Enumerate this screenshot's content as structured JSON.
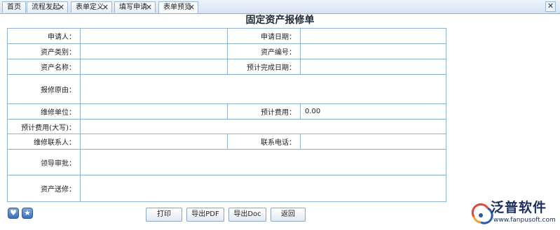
{
  "tabs": [
    {
      "label": "首页",
      "closable": false
    },
    {
      "label": "流程发起",
      "closable": true
    },
    {
      "label": "表单定义",
      "closable": true
    },
    {
      "label": "填写申请",
      "closable": true
    },
    {
      "label": "表单预览",
      "closable": true,
      "active": true
    }
  ],
  "window": {
    "close_glyph": "✕"
  },
  "form": {
    "title": "固定资产报修单",
    "applicant_label": "申请人：",
    "apply_date_label": "申请日期：",
    "asset_category_label": "资产类别：",
    "asset_number_label": "资产编号：",
    "asset_name_label": "资产名称：",
    "expected_finish_label": "预计完成日期：",
    "repair_reason_label": "报修原由：",
    "repair_unit_label": "维修单位：",
    "expected_cost_label": "预计费用：",
    "expected_cost_value": "0.00",
    "expected_cost_caps_label": "预计费用(大写)：",
    "repair_contact_label": "维修联系人：",
    "contact_phone_label": "联系电话：",
    "leader_approval_label": "领导审批：",
    "asset_send_label": "资产送修："
  },
  "buttons": {
    "print": "打印",
    "export_pdf": "导出PDF",
    "export_doc": "导出Doc",
    "back": "返回"
  },
  "icons": {
    "heart": "heart-icon",
    "star": "star-icon"
  },
  "brand": {
    "name": "泛普软件",
    "url": "www.fanpusoft.com",
    "color": "#1a2f5e"
  }
}
